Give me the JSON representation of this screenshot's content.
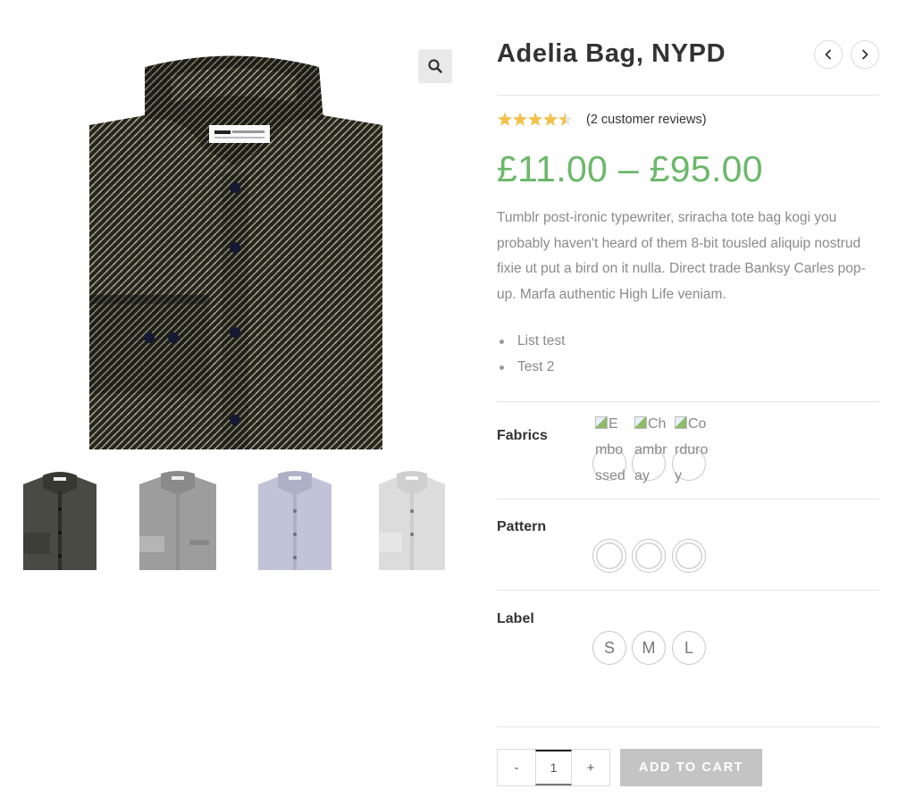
{
  "product": {
    "title": "Adelia Bag, NYPD",
    "rating": 4.5,
    "rating_max": 5,
    "review_text": "(2 customer reviews)",
    "price": "£11.00 – £95.00",
    "description": "Tumblr post-ironic typewriter, sriracha tote bag kogi you probably haven't heard of them 8-bit tousled aliquip nostrud fixie ut put a bird on it nulla. Direct trade Banksy Carles pop-up. Marfa authentic High Life veniam.",
    "bullets": [
      "List test",
      "Test 2"
    ]
  },
  "gallery": {
    "thumbnails": [
      {
        "shirt_color": "#4a4a44"
      },
      {
        "shirt_color": "#9d9d9d"
      },
      {
        "shirt_color": "#c1c4d8"
      },
      {
        "shirt_color": "#dcdcdc"
      }
    ]
  },
  "attributes": {
    "fabrics": {
      "label": "Fabrics",
      "options": [
        "Embossed",
        "Chambray",
        "Corduroy"
      ]
    },
    "pattern": {
      "label": "Pattern",
      "option_count": 3
    },
    "label": {
      "label": "Label",
      "options": [
        "S",
        "M",
        "L"
      ]
    }
  },
  "cart": {
    "minus": "-",
    "quantity": "1",
    "plus": "+",
    "button": "ADD TO CART"
  },
  "colors": {
    "price": "#6cb86a",
    "star": "#f2c14a",
    "cart_button": "#c4c4c4"
  },
  "icons": {
    "zoom": "magnifier-icon",
    "prev": "chevron-left-icon",
    "next": "chevron-right-icon"
  }
}
